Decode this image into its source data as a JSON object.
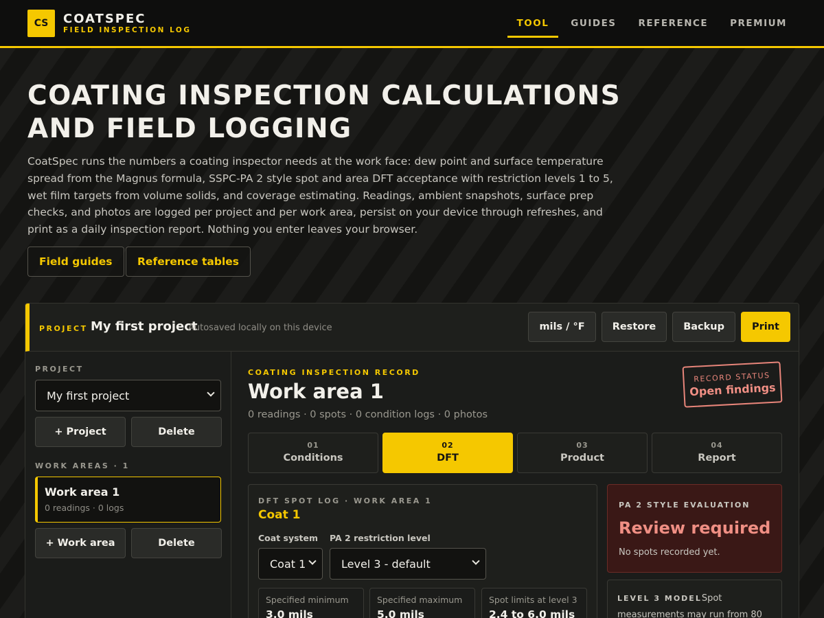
{
  "header": {
    "logo_text": "CS",
    "brand_name": "COATSPEC",
    "brand_tagline": "FIELD INSPECTION LOG",
    "nav": [
      {
        "label": "TOOL",
        "active": true
      },
      {
        "label": "GUIDES",
        "active": false
      },
      {
        "label": "REFERENCE",
        "active": false
      },
      {
        "label": "PREMIUM",
        "active": false
      }
    ]
  },
  "hero": {
    "title": "COATING INSPECTION CALCULATIONS AND FIELD LOGGING",
    "description": "CoatSpec runs the numbers a coating inspector needs at the work face: dew point and surface temperature spread from the Magnus formula, SSPC-PA 2 style spot and area DFT acceptance with restriction levels 1 to 5, wet film targets from volume solids, and coverage estimating. Readings, ambient snapshots, surface prep checks, and photos are logged per project and per work area, persist on your device through refreshes, and print as a daily inspection report. Nothing you enter leaves your browser.",
    "buttons": [
      "Field guides",
      "Reference tables"
    ]
  },
  "project_bar": {
    "label": "PROJECT",
    "name": "My first project",
    "autosave_note": "Autosaved locally on this device",
    "buttons": {
      "units": "mils / °F",
      "restore": "Restore",
      "backup": "Backup",
      "print": "Print"
    }
  },
  "sidebar": {
    "project_label": "PROJECT",
    "project_selected": "My first project",
    "add_project": "+ Project",
    "delete_project": "Delete",
    "work_areas_label": "WORK AREAS · 1",
    "work_areas": [
      {
        "name": "Work area 1",
        "meta": "0 readings · 0 logs",
        "selected": true
      }
    ],
    "add_work_area": "+ Work area",
    "delete_work_area": "Delete"
  },
  "record": {
    "eyebrow": "COATING INSPECTION RECORD",
    "title": "Work area 1",
    "meta": "0 readings · 0 spots · 0 condition logs · 0 photos",
    "status_label": "RECORD STATUS",
    "status_value": "Open findings",
    "tabs": [
      {
        "num": "01",
        "label": "Conditions",
        "active": false
      },
      {
        "num": "02",
        "label": "DFT",
        "active": true
      },
      {
        "num": "03",
        "label": "Product",
        "active": false
      },
      {
        "num": "04",
        "label": "Report",
        "active": false
      }
    ]
  },
  "dft_log": {
    "eyebrow": "DFT SPOT LOG · WORK AREA 1",
    "coat_title": "Coat 1",
    "coat_system_label": "Coat system",
    "coat_system_value": "Coat 1",
    "restriction_label": "PA 2 restriction level",
    "restriction_value": "Level 3 - default",
    "stats": [
      {
        "label": "Specified minimum",
        "value": "3.0 mils"
      },
      {
        "label": "Specified maximum",
        "value": "5.0 mils"
      },
      {
        "label": "Spot limits at level 3",
        "value": "2.4 to 6.0 mils"
      }
    ]
  },
  "evaluation": {
    "eyebrow": "PA 2 STYLE EVALUATION",
    "status": "Review required",
    "note": "No spots recorded yet."
  },
  "model": {
    "label": "LEVEL 3 MODEL",
    "text": "Spot measurements may run from 80"
  },
  "colors": {
    "accent": "#f5c800",
    "background": "#141412",
    "alert_text": "#f08f84",
    "alert_bg": "#3a1816"
  }
}
